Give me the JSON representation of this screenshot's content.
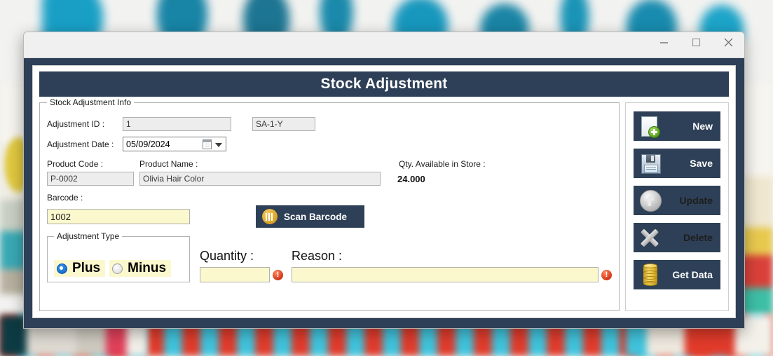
{
  "window": {
    "controls": {
      "minimize": "minimize-button",
      "maximize": "maximize-button",
      "close": "close-button"
    }
  },
  "form": {
    "title": "Stock Adjustment",
    "groupbox_caption": "Stock Adjustment Info",
    "fields": {
      "adjustment_id_label": "Adjustment ID :",
      "adjustment_id_value": "1",
      "adjustment_code_value": "SA-1-Y",
      "adjustment_date_label": "Adjustment Date :",
      "adjustment_date_value": "05/09/2024",
      "product_code_label": "Product Code :",
      "product_code_value": "P-0002",
      "product_name_label": "Product Name :",
      "product_name_value": "Olivia Hair Color",
      "qty_available_label": "Qty. Available in Store :",
      "qty_available_value": "24.000",
      "barcode_label": "Barcode :",
      "barcode_value": "1002",
      "quantity_label": "Quantity :",
      "quantity_value": "",
      "reason_label": "Reason :",
      "reason_value": ""
    },
    "scan_button": "Scan Barcode",
    "adjustment_type": {
      "caption": "Adjustment Type",
      "options": [
        {
          "label": "Plus",
          "selected": true
        },
        {
          "label": "Minus",
          "selected": false
        }
      ]
    },
    "validation": {
      "quantity_error": "!",
      "reason_error": "!"
    }
  },
  "actions": [
    {
      "label": "New",
      "icon": "new-document-icon",
      "enabled": true
    },
    {
      "label": "Save",
      "icon": "floppy-disk-icon",
      "enabled": true
    },
    {
      "label": "Update",
      "icon": "up-arrow-circle-icon",
      "enabled": false
    },
    {
      "label": "Delete",
      "icon": "cross-icon",
      "enabled": false
    },
    {
      "label": "Get Data",
      "icon": "database-icon",
      "enabled": true
    }
  ],
  "colors": {
    "chrome_navy": "#2e4057",
    "field_yellow": "#fbf8cd",
    "accent_gold": "#d79f21",
    "error_red": "#cc2b10"
  }
}
